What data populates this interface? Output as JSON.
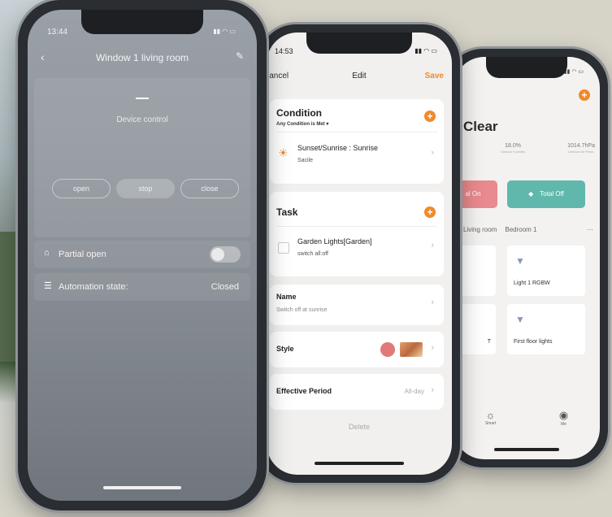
{
  "phone_left": {
    "status_time": "13:44",
    "title": "Window 1 living room",
    "section_label": "Device control",
    "controls": [
      "open",
      "stop",
      "close"
    ],
    "active_control": "stop",
    "partial_open": {
      "label": "Partial open",
      "enabled": false
    },
    "automation": {
      "label": "Automation state:",
      "value": "Closed"
    }
  },
  "phone_middle": {
    "status_time": "14:53",
    "nav": {
      "cancel": "Cancel",
      "title": "Edit",
      "save": "Save"
    },
    "condition": {
      "title": "Condition",
      "subtitle": "Any Condition is Met",
      "item_title": "Sunset/Sunrise : Sunrise",
      "item_subtitle": "Sacile"
    },
    "task": {
      "title": "Task",
      "item_title": "Garden Lights[Garden]",
      "item_subtitle": "switch all:off"
    },
    "name": {
      "label": "Name",
      "value": "Switch off at sunrise"
    },
    "style": {
      "label": "Style",
      "color": "#e07a78"
    },
    "effective_period": {
      "label": "Effective Period",
      "value": "All-day"
    },
    "delete_label": "Delete"
  },
  "phone_right": {
    "weather": "Clear",
    "stats": [
      {
        "value": "",
        "label": ""
      },
      {
        "value": "18.0%",
        "label": "Outdoor humidity"
      },
      {
        "value": "1014.7hPa",
        "label": "Outdoor Air Press."
      }
    ],
    "btn_on": "al On",
    "btn_off": "Total Off",
    "rooms": [
      "Living room",
      "Bedroom 1",
      "···"
    ],
    "cards": [
      {
        "label": "Light 1 RGBW"
      },
      {
        "label": "T"
      },
      {
        "label": "First floor lights"
      }
    ],
    "tabs": [
      {
        "icon": "sun-icon",
        "label": "Smart"
      },
      {
        "icon": "user-icon",
        "label": "Me"
      }
    ]
  },
  "colors": {
    "accent": "#ef8a2c",
    "teal": "#5fb8ab",
    "pink": "#e98a8e"
  }
}
